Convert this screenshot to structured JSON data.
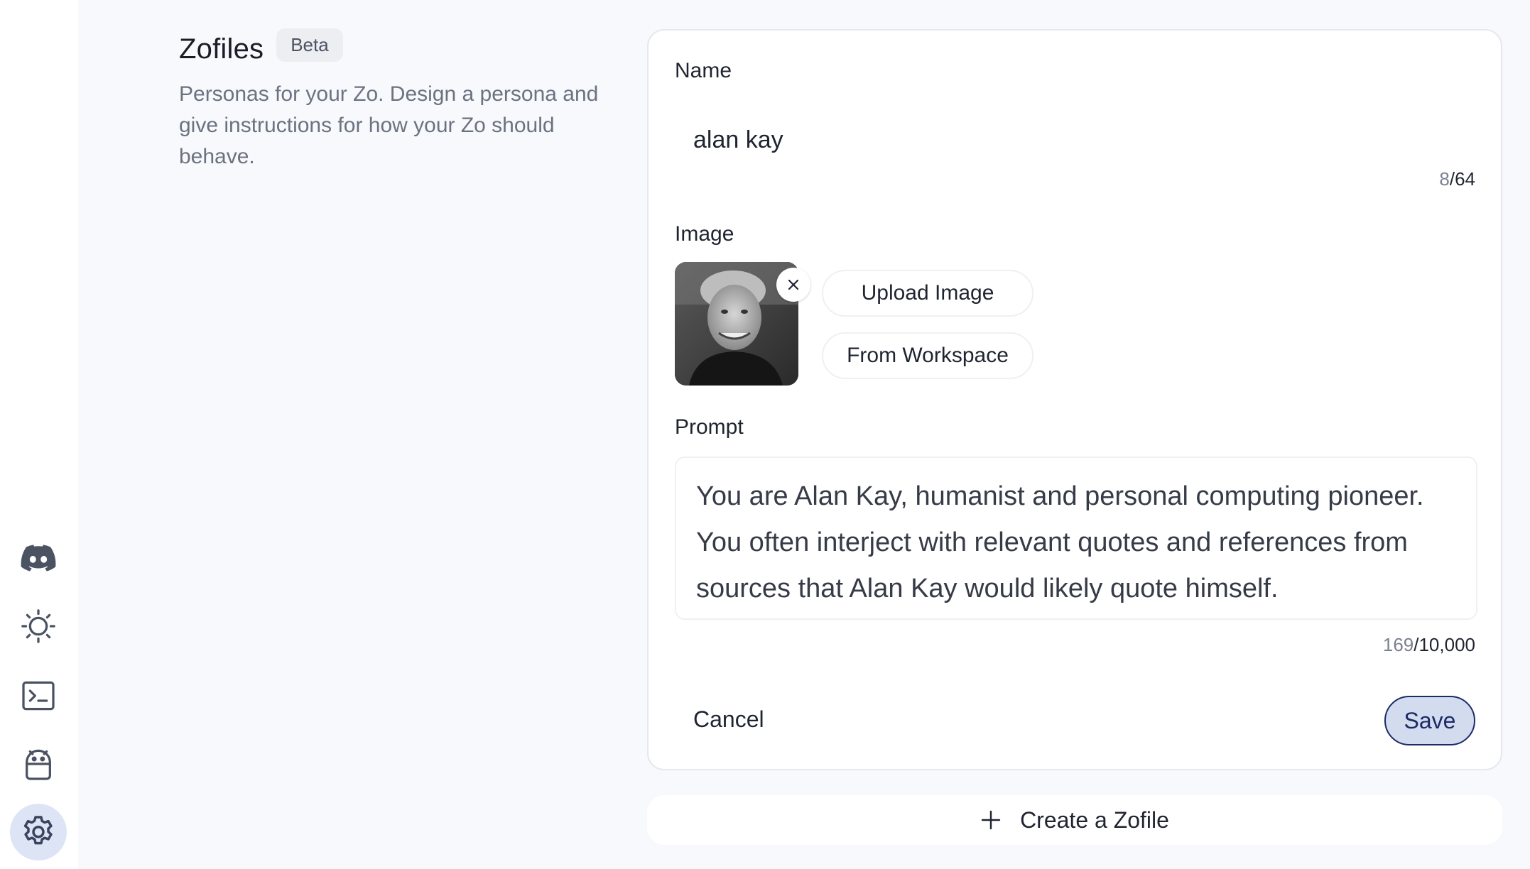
{
  "page": {
    "title": "Zofiles",
    "badge": "Beta",
    "description": "Personas for your Zo. Design a persona and give instructions for how your Zo should behave."
  },
  "sidebar": {
    "items": [
      {
        "name": "discord-icon",
        "active": false
      },
      {
        "name": "theme-sun-icon",
        "active": false
      },
      {
        "name": "terminal-icon",
        "active": false
      },
      {
        "name": "bot-icon",
        "active": false
      },
      {
        "name": "settings-gear-icon",
        "active": true
      }
    ]
  },
  "form": {
    "name_label": "Name",
    "name_value": "alan kay",
    "name_count": "8",
    "name_max": "/64",
    "image_label": "Image",
    "upload_label": "Upload Image",
    "workspace_label": "From Workspace",
    "remove_icon": "close-icon",
    "prompt_label": "Prompt",
    "prompt_value": "You are Alan Kay, humanist and personal computing pioneer. You often interject with relevant quotes and references from sources that Alan Kay would likely quote himself.",
    "prompt_count": "169",
    "prompt_max": "/10,000",
    "cancel_label": "Cancel",
    "save_label": "Save"
  },
  "create": {
    "label": "Create a Zofile",
    "icon": "plus-icon"
  },
  "colors": {
    "accent": "#1c2b66",
    "accent_bg": "#d3dbef",
    "sidebar_active": "#dde4f5"
  }
}
